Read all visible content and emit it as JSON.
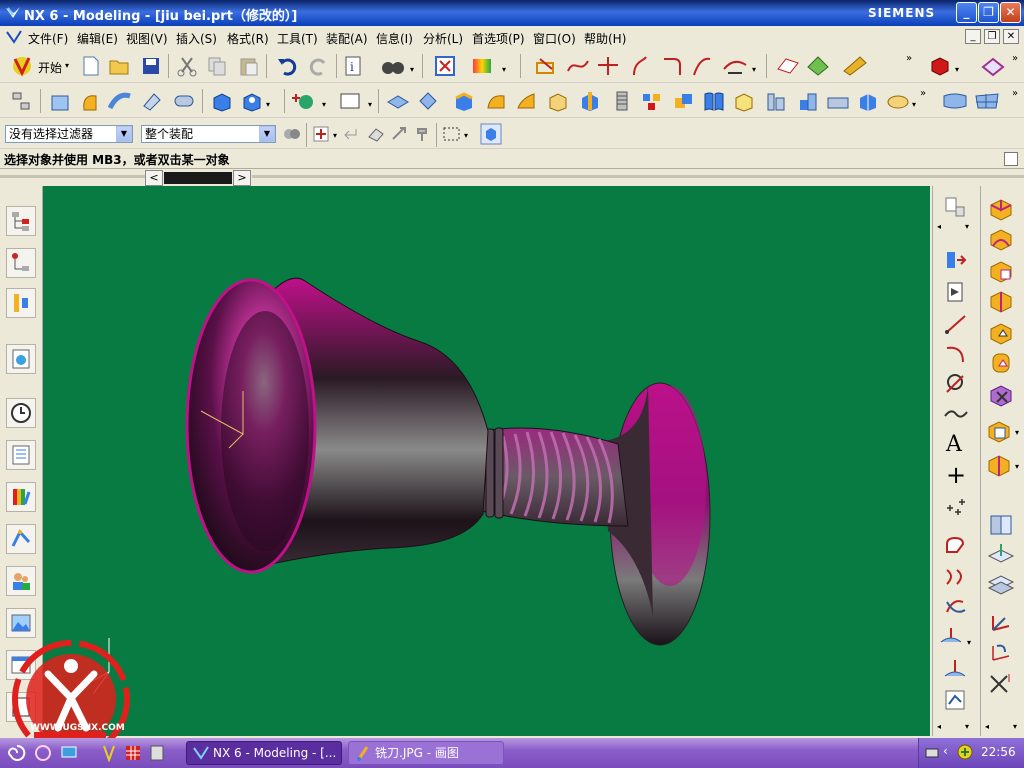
{
  "window": {
    "title": "NX 6 - Modeling - [jiu bei.prt（修改的）]",
    "brand": "SIEMENS",
    "controls": [
      "_",
      "❐",
      "✕"
    ]
  },
  "menu": {
    "items": [
      "文件(F)",
      "编辑(E)",
      "视图(V)",
      "插入(S)",
      "格式(R)",
      "工具(T)",
      "装配(A)",
      "信息(I)",
      "分析(L)",
      "首选项(P)",
      "窗口(O)",
      "帮助(H)"
    ],
    "mdi_controls": [
      "_",
      "❐",
      "✕"
    ]
  },
  "toolbar_standard": {
    "start_label": "开始",
    "start_arrow": "▾"
  },
  "filter_bar": {
    "selection_filter": "没有选择过滤器",
    "scope": "整个装配",
    "arrow": "▼"
  },
  "status": {
    "prompt": "选择对象并使用 MB3，或者双击某一对象"
  },
  "scroll": {
    "left": "<",
    "right": ">"
  },
  "right_toolbar": {
    "text_icon": "A",
    "plus_icon": "+"
  },
  "watermark": {
    "site": "WWW.UGSNX.COM"
  },
  "taskbar": {
    "tasks": [
      {
        "label": "NX 6 - Modeling - [..."
      },
      {
        "label": "铣刀.JPG - 画图"
      }
    ],
    "clock": "22:56"
  },
  "colors": {
    "viewport_bg": "#077b41",
    "model_magenta": "#c0108a",
    "model_dark": "#1a1018"
  }
}
